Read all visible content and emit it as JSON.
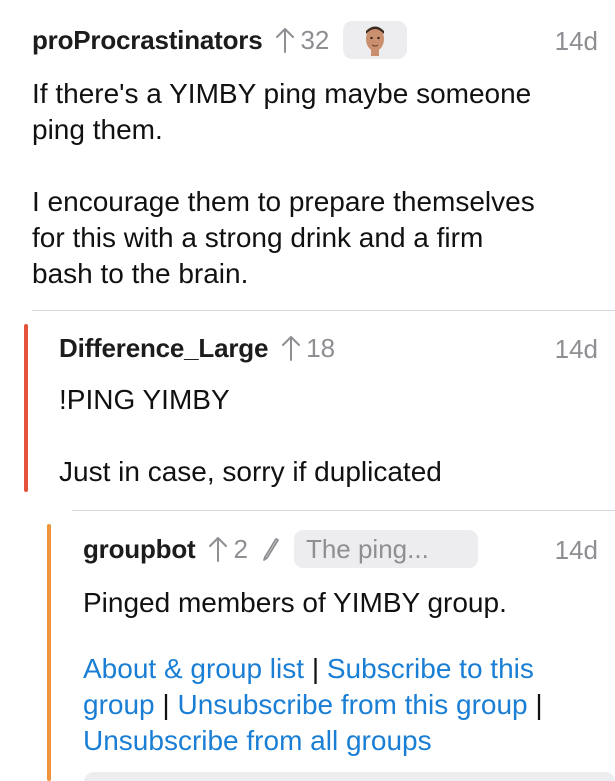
{
  "comments": [
    {
      "username": "proProcrastinators",
      "score": "32",
      "age": "14d",
      "body": "If there's a YIMBY ping maybe someone\nping them.\n\nI encourage them to prepare themselves\nfor this with a strong drink and a firm\nbash to the brain."
    },
    {
      "username": "Difference_Large",
      "score": "18",
      "age": "14d",
      "body": "!PING YIMBY\n\nJust in case, sorry if duplicated",
      "thread_color": "#e5533d"
    },
    {
      "username": "groupbot",
      "score": "2",
      "age": "14d",
      "flair": "The ping...",
      "body": "Pinged members of YIMBY group.",
      "thread_color": "#f0943a",
      "links": {
        "about": "About & group list",
        "subscribe": "Subscribe to this group",
        "unsubscribe": "Unsubscribe from this group",
        "unsubscribe_all": "Unsubscribe from all groups",
        "separator": "|"
      }
    }
  ],
  "colors": {
    "link": "#1a7fd4",
    "meta": "#8e8e93",
    "divider": "#d8d8dc"
  },
  "icons": {
    "upvote": "up-arrow-icon",
    "edited": "pencil-icon",
    "avatar": "user-avatar-flair"
  }
}
